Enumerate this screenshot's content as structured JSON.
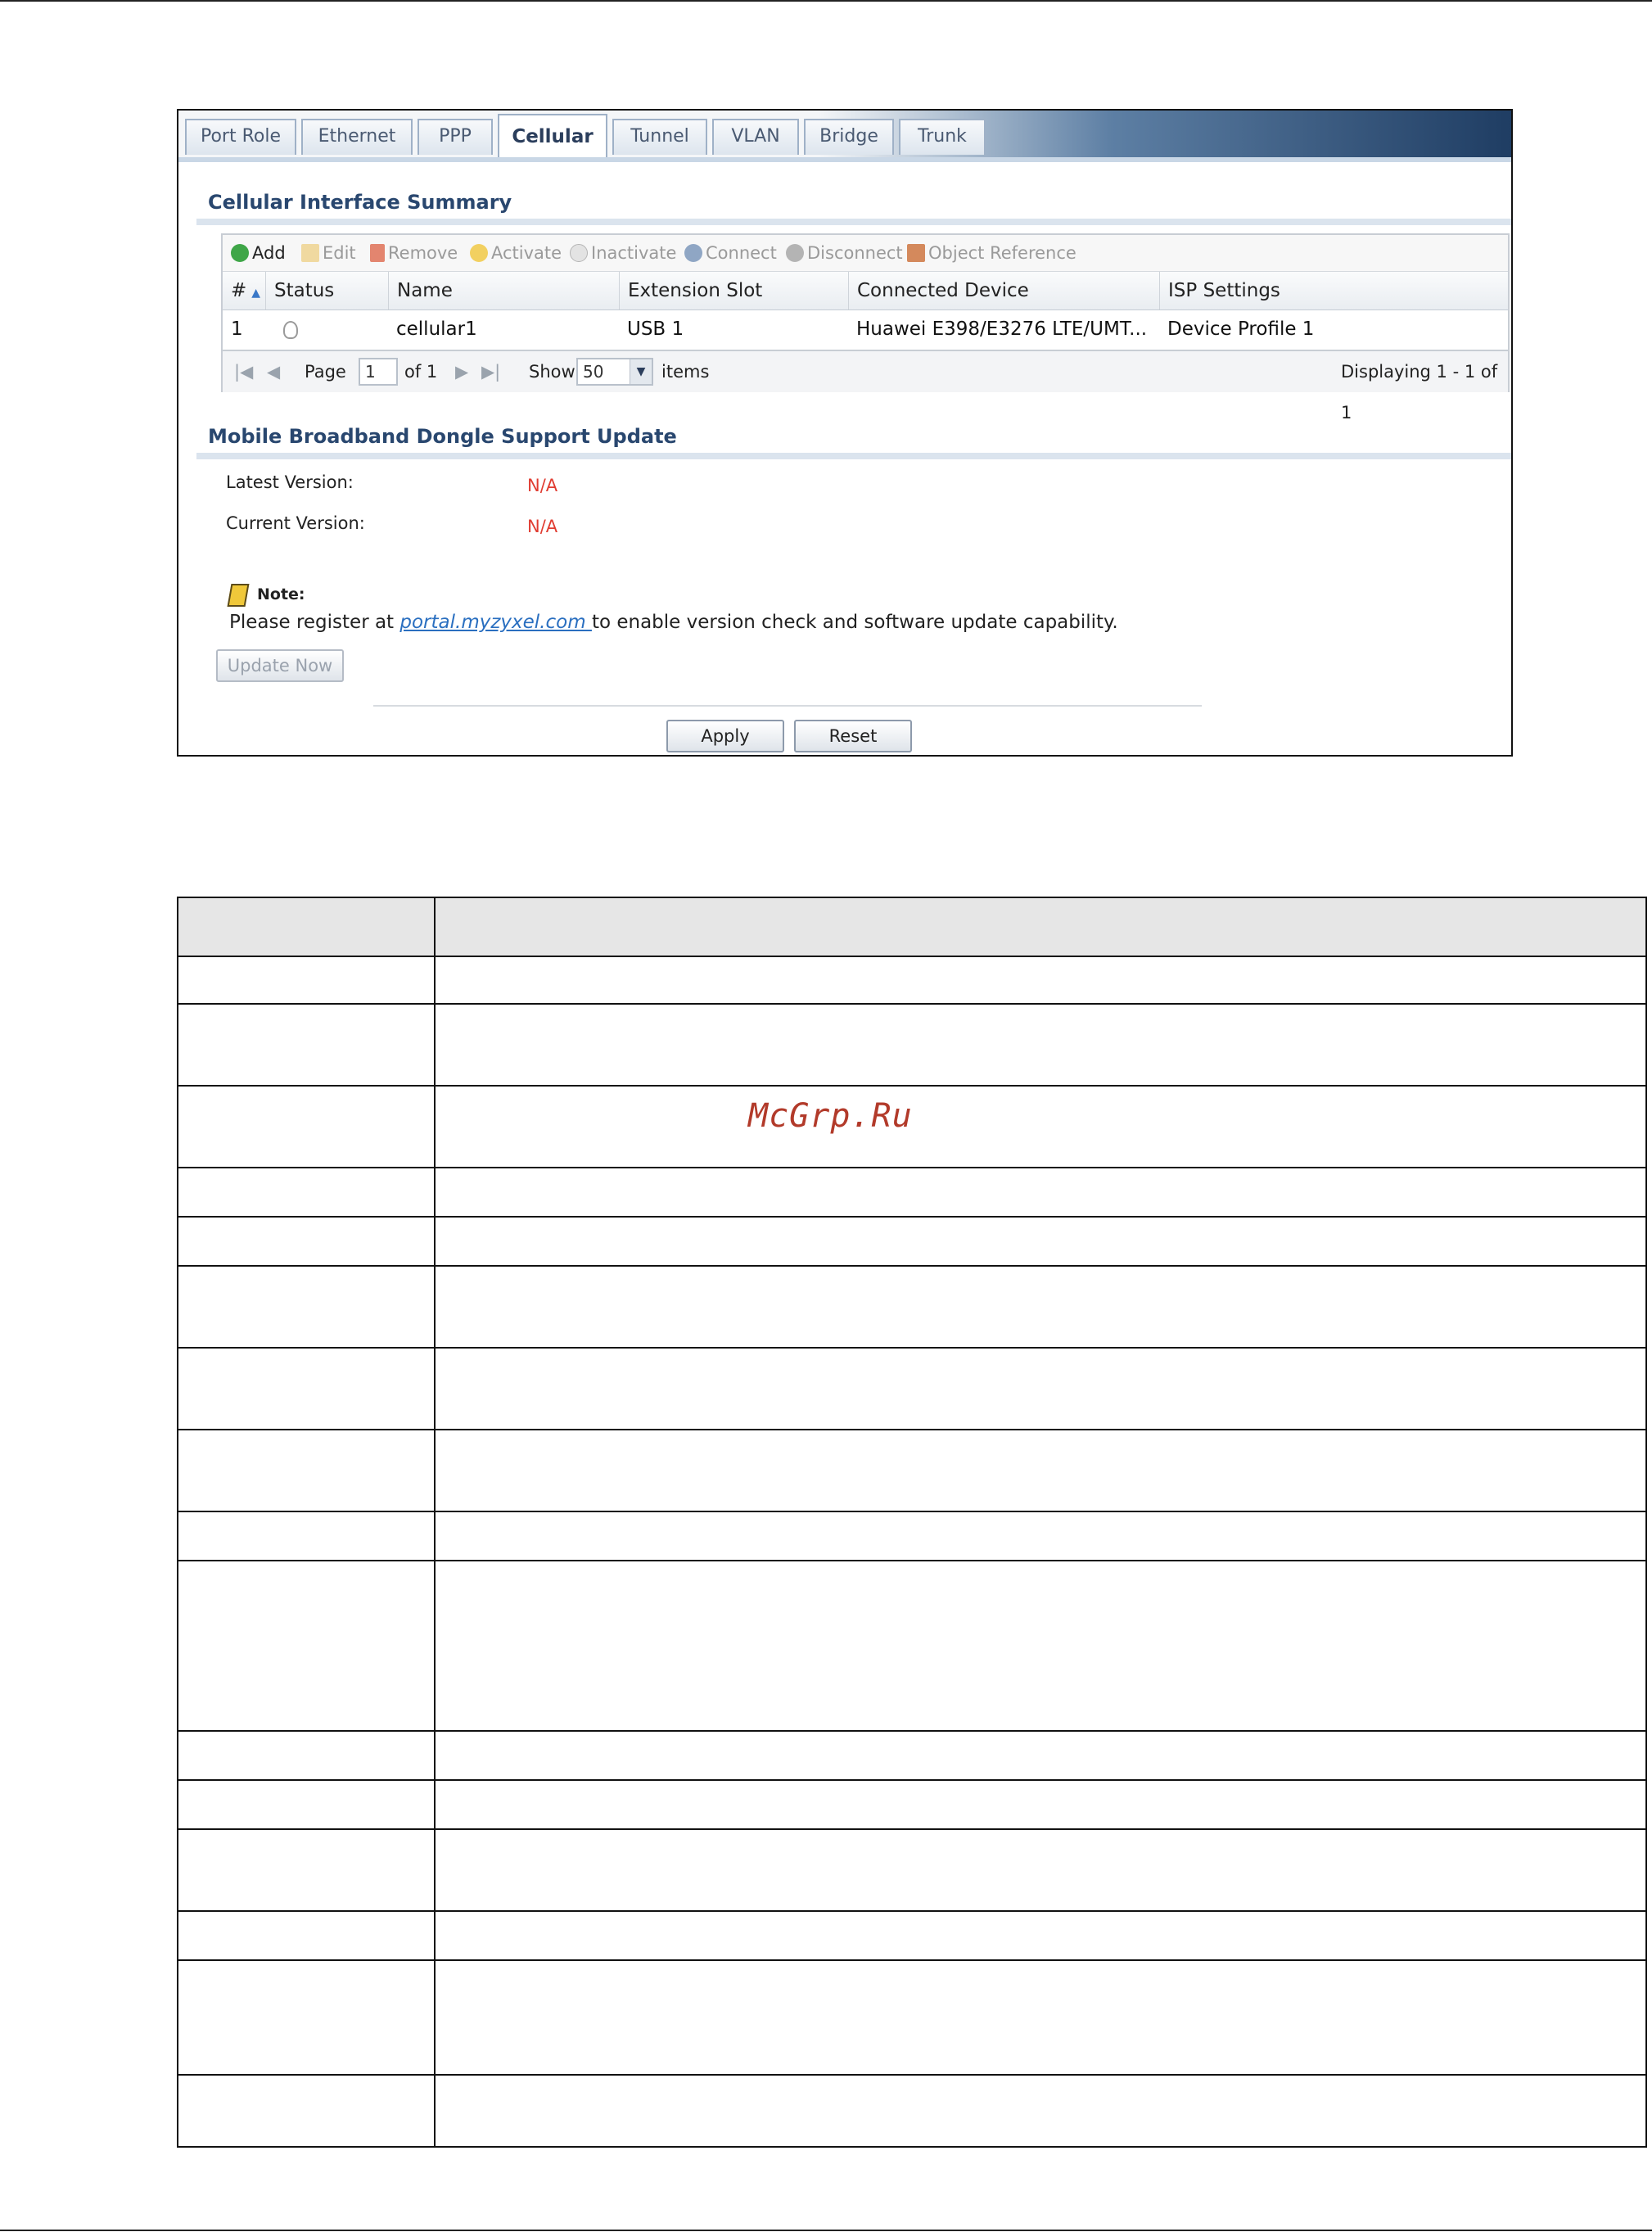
{
  "tabs": [
    "Port Role",
    "Ethernet",
    "PPP",
    "Cellular",
    "Tunnel",
    "VLAN",
    "Bridge",
    "Trunk"
  ],
  "active_tab": "Cellular",
  "cellular_summary": {
    "title": "Cellular Interface Summary",
    "toolbar": {
      "add": "Add",
      "edit": "Edit",
      "remove": "Remove",
      "activate": "Activate",
      "inactivate": "Inactivate",
      "connect": "Connect",
      "disconnect": "Disconnect",
      "object_reference": "Object Reference"
    },
    "columns": [
      "#",
      "Status",
      "Name",
      "Extension Slot",
      "Connected Device",
      "ISP Settings"
    ],
    "rows": [
      {
        "index": "1",
        "status_icon": "bulb-inactive-icon",
        "name": "cellular1",
        "extension_slot": "USB 1",
        "connected_device": "Huawei E398/E3276 LTE/UMT...",
        "isp_settings": "Device Profile 1"
      }
    ],
    "pager": {
      "page_label": "Page",
      "page_value": "1",
      "of_label": "of 1",
      "show_label": "Show",
      "show_value": "50",
      "items_label": "items",
      "displaying": "Displaying 1 - 1 of 1"
    }
  },
  "dongle_update": {
    "title": "Mobile Broadband Dongle Support Update",
    "latest_label": "Latest Version:",
    "latest_value": "N/A",
    "current_label": "Current Version:",
    "current_value": "N/A",
    "note_label": "Note:",
    "note_prefix": "Please register at ",
    "note_link": "portal.myzyxel.com ",
    "note_suffix": "to enable version check and software update capability.",
    "update_button": "Update Now"
  },
  "buttons": {
    "apply": "Apply",
    "reset": "Reset"
  },
  "watermark": "McGrp.Ru"
}
